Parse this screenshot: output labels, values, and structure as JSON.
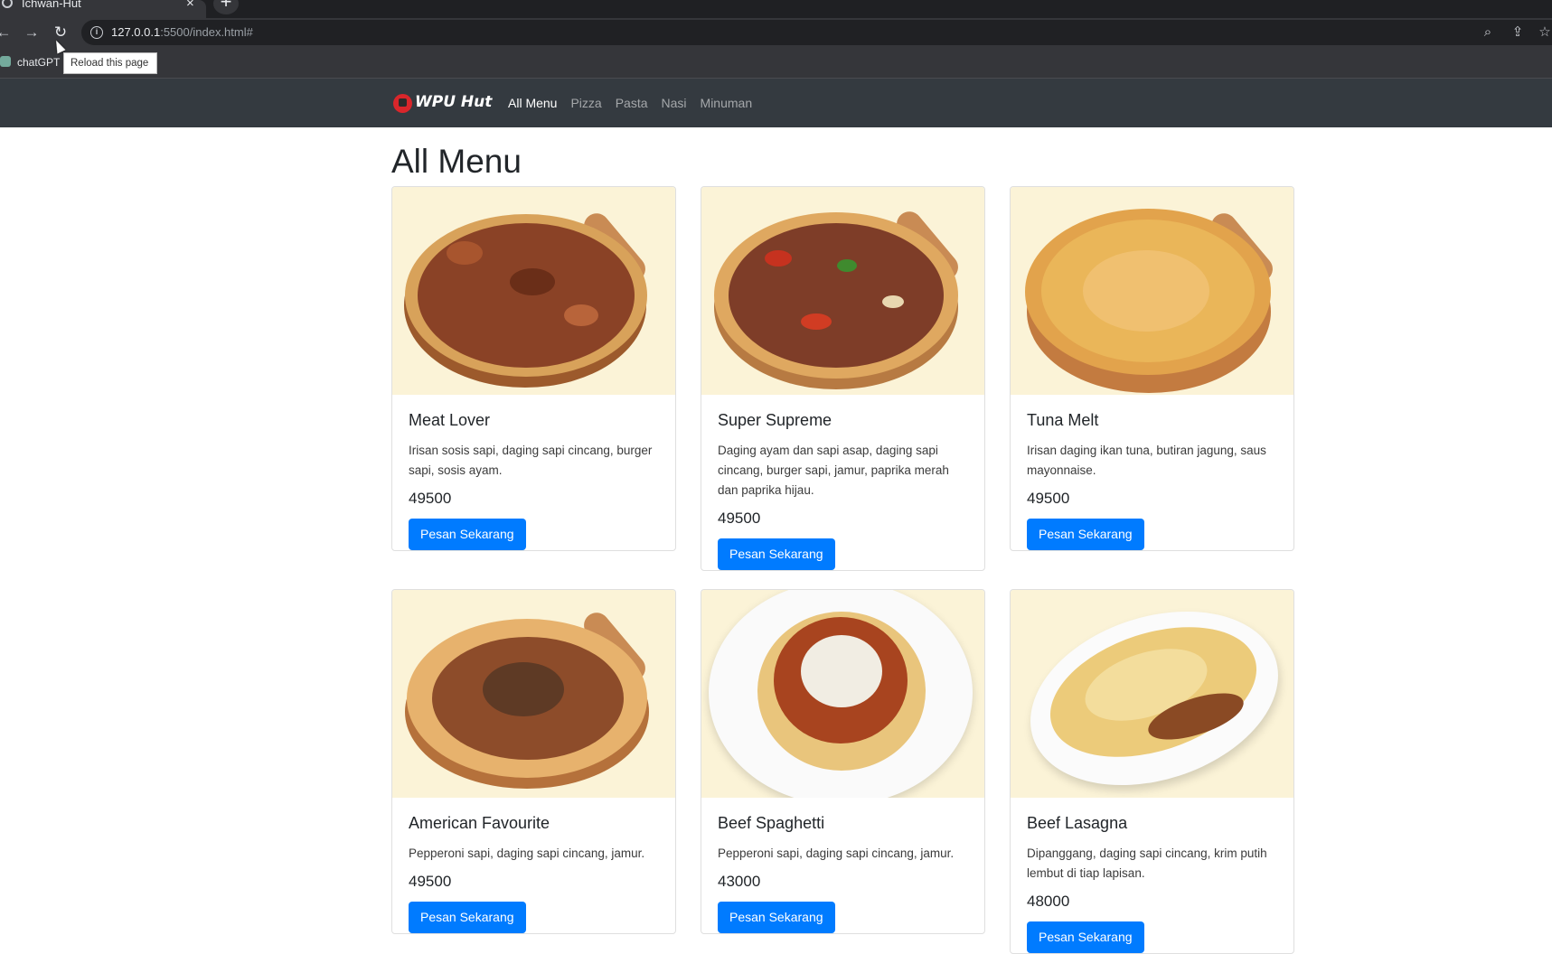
{
  "browser": {
    "tab_title": "Ichwan-Hut",
    "tab_close": "×",
    "new_tab": "+",
    "url_host": "127.0.0.1",
    "url_rest": ":5500/index.html#",
    "bookmark_label": "chatGPT",
    "tooltip": "Reload this page",
    "icons": {
      "back": "back-arrow-icon",
      "forward": "forward-arrow-icon",
      "reload": "reload-icon",
      "info": "site-info-icon",
      "zoom": "zoom-icon",
      "share": "share-icon",
      "bookmark_star": "star-icon"
    }
  },
  "navbar": {
    "brand": "WPU Hut",
    "links": [
      {
        "label": "All Menu",
        "active": true
      },
      {
        "label": "Pizza",
        "active": false
      },
      {
        "label": "Pasta",
        "active": false
      },
      {
        "label": "Nasi",
        "active": false
      },
      {
        "label": "Minuman",
        "active": false
      }
    ]
  },
  "main": {
    "title": "All Menu",
    "cards": [
      {
        "name": "Meat Lover",
        "description": "Irisan sosis sapi, daging sapi cincang, burger sapi, sosis ayam.",
        "price": "49500",
        "button": "Pesan Sekarang"
      },
      {
        "name": "Super Supreme",
        "description": "Daging ayam dan sapi asap, daging sapi cincang, burger sapi, jamur, paprika merah dan paprika hijau.",
        "price": "49500",
        "button": "Pesan Sekarang"
      },
      {
        "name": "Tuna Melt",
        "description": "Irisan daging ikan tuna, butiran jagung, saus mayonnaise.",
        "price": "49500",
        "button": "Pesan Sekarang"
      },
      {
        "name": "American Favourite",
        "description": "Pepperoni sapi, daging sapi cincang, jamur.",
        "price": "49500",
        "button": "Pesan Sekarang"
      },
      {
        "name": "Beef Spaghetti",
        "description": "Pepperoni sapi, daging sapi cincang, jamur.",
        "price": "43000",
        "button": "Pesan Sekarang"
      },
      {
        "name": "Beef Lasagna",
        "description": "Dipanggang, daging sapi cincang, krim putih lembut di tiap lapisan.",
        "price": "48000",
        "button": "Pesan Sekarang"
      }
    ]
  },
  "colors": {
    "navbar_bg": "#343a40",
    "button": "#007bff",
    "image_bg": "#fbf3d7"
  }
}
